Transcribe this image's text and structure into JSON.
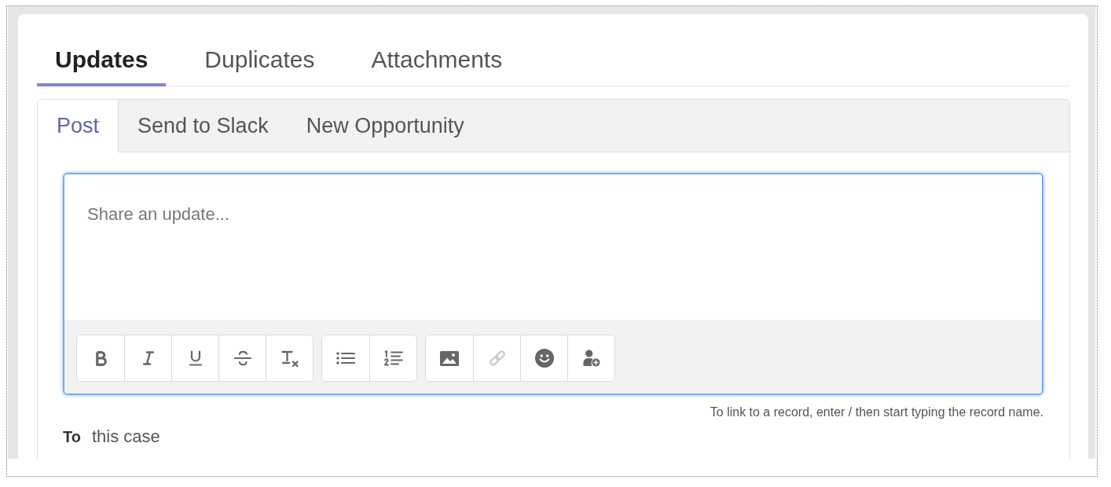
{
  "tabs": [
    {
      "label": "Updates",
      "selected": true
    },
    {
      "label": "Duplicates",
      "selected": false
    },
    {
      "label": "Attachments",
      "selected": false
    }
  ],
  "composer": {
    "tabs": [
      {
        "label": "Post",
        "selected": true
      },
      {
        "label": "Send to Slack",
        "selected": false
      },
      {
        "label": "New Opportunity",
        "selected": false
      }
    ],
    "editor": {
      "placeholder": "Share an update...",
      "focused": true,
      "toolbar_groups": [
        {
          "buttons": [
            {
              "kind": "bold",
              "disabled": false
            },
            {
              "kind": "italic",
              "disabled": false
            },
            {
              "kind": "underline",
              "disabled": false
            },
            {
              "kind": "strikethrough",
              "disabled": false
            },
            {
              "kind": "clear_format",
              "disabled": false
            }
          ]
        },
        {
          "buttons": [
            {
              "kind": "bulleted_list",
              "disabled": false
            },
            {
              "kind": "numbered_list",
              "disabled": false
            }
          ]
        },
        {
          "buttons": [
            {
              "kind": "image",
              "disabled": false
            },
            {
              "kind": "link",
              "disabled": true
            },
            {
              "kind": "emoji",
              "disabled": false
            },
            {
              "kind": "add_person",
              "disabled": false
            }
          ]
        }
      ]
    },
    "hint": "To link to a record, enter / then start typing the record name.",
    "recipient": {
      "label": "To",
      "value": "this case"
    }
  }
}
